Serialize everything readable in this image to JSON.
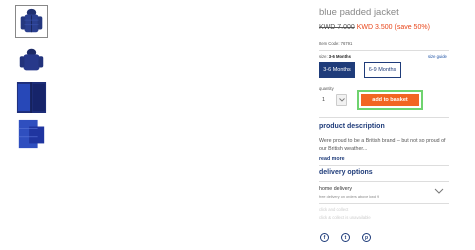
{
  "product": {
    "title": "blue padded jacket",
    "old_price": "KWD 7.000",
    "new_price": "KWD 3.500",
    "save": "(save 50%)",
    "item_code": "Item Code: 76791"
  },
  "size": {
    "label": "size:",
    "selected": "3-6 Months",
    "guide_link": "size guide",
    "options": [
      "3-6 Months",
      "6-9 Months"
    ]
  },
  "quantity": {
    "label": "quantity",
    "value": "1"
  },
  "cart": {
    "add_label": "add to basket"
  },
  "description": {
    "heading": "product description",
    "text": "Were proud to be a British brand – but not so proud of our British weather...",
    "read_more": "read more"
  },
  "delivery": {
    "heading": "delivery options",
    "home_title": "home delivery",
    "home_sub": "free delivery on orders above kwd 9",
    "faded_1": "click and collect",
    "faded_2": "click & collect is unavailable"
  },
  "social": {
    "icons": [
      "facebook-icon",
      "twitter-icon",
      "pinterest-icon"
    ],
    "labels": [
      "f",
      "t",
      "p"
    ]
  },
  "colors": {
    "navy": "#1f3c7a",
    "orange": "#f26522",
    "sale_red": "#e8461b",
    "highlight_green": "#6fd36f"
  }
}
